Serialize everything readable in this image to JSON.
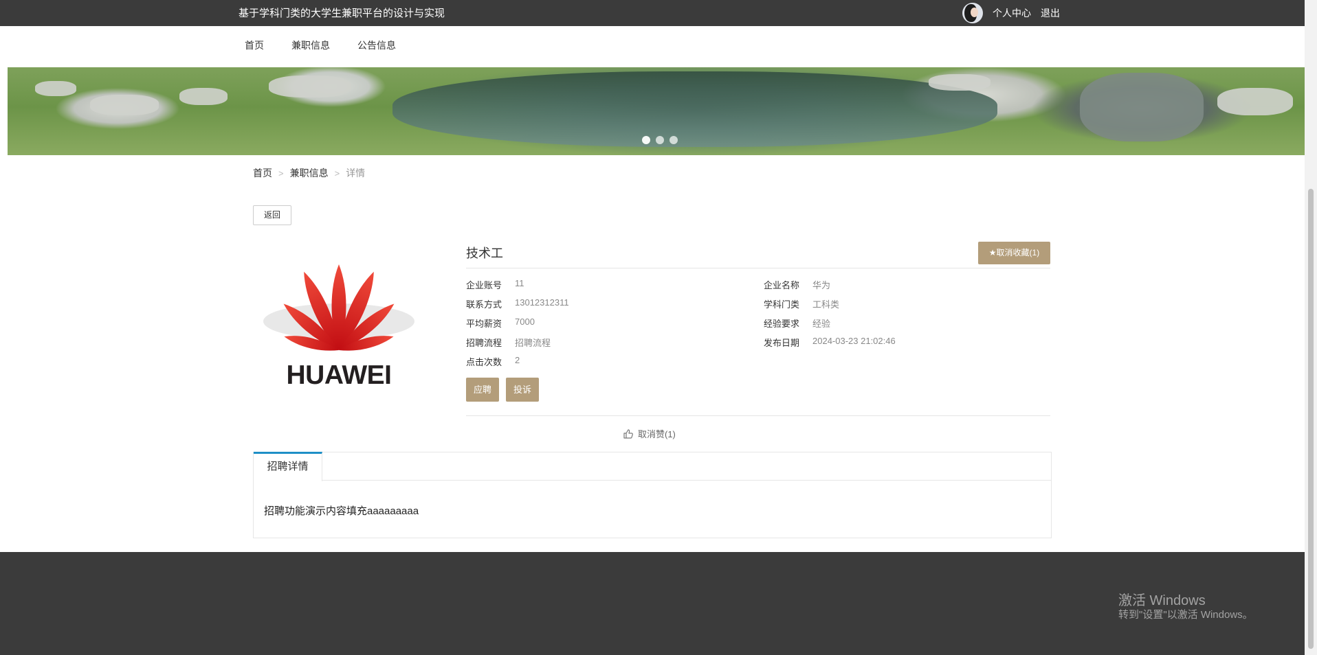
{
  "header": {
    "site_title": "基于学科门类的大学生兼职平台的设计与实现",
    "user_center": "个人中心",
    "logout": "退出"
  },
  "nav": {
    "items": [
      "首页",
      "兼职信息",
      "公告信息"
    ]
  },
  "banner": {
    "slide_count": 3,
    "active_slide": 1
  },
  "breadcrumb": {
    "home": "首页",
    "section": "兼职信息",
    "current": "详情",
    "separator": ">"
  },
  "back_label": "返回",
  "logo": {
    "company_wordmark": "HUAWEI",
    "petal_color": "#e4151f"
  },
  "job": {
    "title": "技术工",
    "favorite_label": "取消收藏(1)",
    "fields": {
      "company_account": {
        "label": "企业账号",
        "value": "11"
      },
      "company_name": {
        "label": "企业名称",
        "value": "华为"
      },
      "contact": {
        "label": "联系方式",
        "value": "13012312311"
      },
      "discipline": {
        "label": "学科门类",
        "value": "工科类"
      },
      "avg_salary": {
        "label": "平均薪资",
        "value": "7000"
      },
      "experience": {
        "label": "经验要求",
        "value": "经验"
      },
      "process": {
        "label": "招聘流程",
        "value": "招聘流程"
      },
      "publish_date": {
        "label": "发布日期",
        "value": "2024-03-23 21:02:46"
      },
      "clicks": {
        "label": "点击次数",
        "value": "2"
      }
    },
    "apply_label": "应聘",
    "complain_label": "投诉",
    "unlike_label": "取消赞(1)"
  },
  "tabs": {
    "active": "招聘详情",
    "content": "招聘功能演示内容填充aaaaaaaaa"
  },
  "watermark": {
    "line1": "激活 Windows",
    "line2": "转到\"设置\"以激活 Windows。"
  },
  "colors": {
    "topbar": "#3b3b3b",
    "accent_button": "#b39d7a",
    "tab_accent": "#1e8fc6",
    "footer": "#3b3b3b"
  }
}
